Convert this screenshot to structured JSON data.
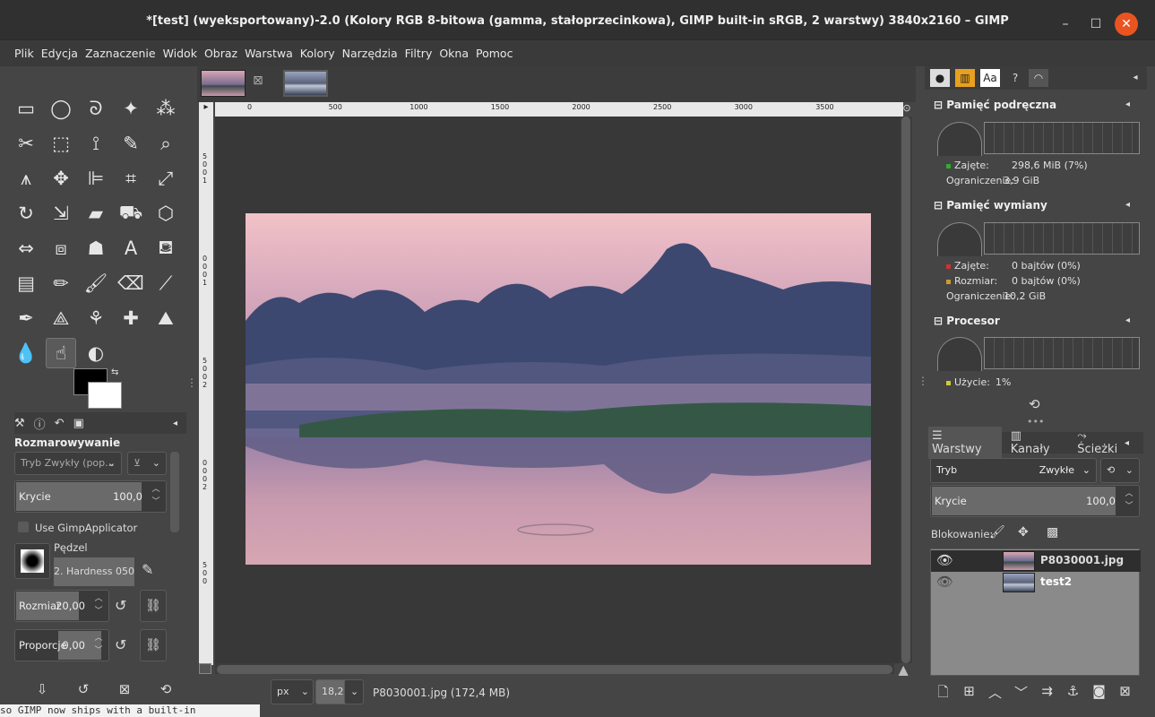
{
  "window": {
    "title": "*[test] (wyeksportowany)-2.0 (Kolory RGB 8-bitowa (gamma, stałoprzecinkowa), GIMP built-in sRGB, 2 warstwy) 3840x2160 – GIMP",
    "minimize": "–",
    "maximize": "☐",
    "close": "✕"
  },
  "menu": [
    "Plik",
    "Edycja",
    "Zaznaczenie",
    "Widok",
    "Obraz",
    "Warstwa",
    "Kolory",
    "Narzędzia",
    "Filtry",
    "Okna",
    "Pomoc"
  ],
  "toolbox": {
    "tools": [
      {
        "name": "rect-select-icon",
        "glyph": "▭"
      },
      {
        "name": "ellipse-select-icon",
        "glyph": "◯"
      },
      {
        "name": "free-select-icon",
        "glyph": "ᘐ"
      },
      {
        "name": "fuzzy-select-icon",
        "glyph": "✦"
      },
      {
        "name": "by-color-select-icon",
        "glyph": "⁂"
      },
      {
        "name": "scissors-select-icon",
        "glyph": "✂"
      },
      {
        "name": "foreground-select-icon",
        "glyph": "⬚"
      },
      {
        "name": "paths-icon",
        "glyph": "⟟"
      },
      {
        "name": "color-picker-icon",
        "glyph": "✎"
      },
      {
        "name": "zoom-icon",
        "glyph": "⌕"
      },
      {
        "name": "measure-icon",
        "glyph": "⩚"
      },
      {
        "name": "move-icon",
        "glyph": "✥"
      },
      {
        "name": "align-icon",
        "glyph": "⊫"
      },
      {
        "name": "crop-icon",
        "glyph": "⌗"
      },
      {
        "name": "unified-transform-icon",
        "glyph": "⤢"
      },
      {
        "name": "rotate-icon",
        "glyph": "↻"
      },
      {
        "name": "scale-icon",
        "glyph": "⇲"
      },
      {
        "name": "shear-icon",
        "glyph": "▰"
      },
      {
        "name": "warp-icon",
        "glyph": "⛟"
      },
      {
        "name": "perspective-icon",
        "glyph": "⬡"
      },
      {
        "name": "flip-icon",
        "glyph": "⇔"
      },
      {
        "name": "cage-icon",
        "glyph": "⧈"
      },
      {
        "name": "handle-transform-icon",
        "glyph": "☗"
      },
      {
        "name": "text-icon",
        "glyph": "A"
      },
      {
        "name": "bucket-fill-icon",
        "glyph": "⛾"
      },
      {
        "name": "blend-icon",
        "glyph": "▤"
      },
      {
        "name": "pencil-icon",
        "glyph": "✏"
      },
      {
        "name": "paintbrush-icon",
        "glyph": "🖌"
      },
      {
        "name": "eraser-icon",
        "glyph": "⌫"
      },
      {
        "name": "airbrush-icon",
        "glyph": "⟋"
      },
      {
        "name": "ink-icon",
        "glyph": "✒"
      },
      {
        "name": "mypaint-brush-icon",
        "glyph": "⟁"
      },
      {
        "name": "clone-icon",
        "glyph": "⚘"
      },
      {
        "name": "heal-icon",
        "glyph": "✚"
      },
      {
        "name": "perspective-clone-icon",
        "glyph": "⛰"
      },
      {
        "name": "blur-icon",
        "glyph": "💧"
      },
      {
        "name": "smudge-icon",
        "glyph": "☝"
      },
      {
        "name": "dodge-burn-icon",
        "glyph": "◐"
      }
    ],
    "tabs_icons": [
      "tool-options-icon",
      "device-status-icon",
      "undo-history-icon",
      "images-icon"
    ]
  },
  "tool_options": {
    "title": "Rozmarowywanie",
    "mode_placeholder": "Tryb Zwykły (pop...",
    "opacity_label": "Krycie",
    "opacity_value": "100,0",
    "opacity_fraction": 1.0,
    "use_gimp_applicator": "Use GimpApplicator",
    "brush_label": "Pędzel",
    "brush_name": "2. Hardness 050",
    "size_label": "Rozmiar",
    "size_value": "20,00",
    "ratio_label": "Proporcje",
    "ratio_value": "0,00"
  },
  "status": {
    "unit": "px",
    "zoom": "18,2 %",
    "file_info": "P8030001.jpg (172,4 MB)"
  },
  "rulers": {
    "h_ticks": [
      "0",
      "500",
      "1000",
      "1500",
      "2000",
      "2500",
      "3000",
      "3500"
    ],
    "v_ticks": [
      "5",
      "0",
      "0",
      "1",
      "0",
      "0",
      "0",
      "1",
      "5",
      "0",
      "0",
      "2",
      "0",
      "0",
      "0",
      "2",
      "5",
      "0",
      "0"
    ]
  },
  "dashboard": {
    "cache_title": "Pamięć podręczna",
    "cache_used_label": "Zajęte:",
    "cache_used_value": "298,6 MiB (7%)",
    "cache_limit_label": "Ograniczenie:",
    "cache_limit_value": "3,9 GiB",
    "swap_title": "Pamięć wymiany",
    "swap_used_label": "Zajęte:",
    "swap_used_value": "0 bajtów (0%)",
    "swap_size_label": "Rozmiar:",
    "swap_size_value": "0 bajtów (0%)",
    "swap_limit_label": "Ograniczenie:",
    "swap_limit_value": "10,2 GiB",
    "cpu_title": "Procesor",
    "cpu_usage_label": "Użycie:",
    "cpu_usage_value": "1%"
  },
  "layers_panel": {
    "tabs": [
      "Warstwy",
      "Kanały",
      "Ścieżki"
    ],
    "mode_label": "Tryb",
    "mode_value": "Zwykłe",
    "opacity_label": "Krycie",
    "opacity_value": "100,0",
    "lock_label": "Blokowanie:",
    "layers": [
      {
        "name": "P8030001.jpg",
        "visible": true,
        "active": true
      },
      {
        "name": "test2",
        "visible": true,
        "active": false
      }
    ]
  },
  "terminal_fragment": "so GIMP now ships with a built-in"
}
